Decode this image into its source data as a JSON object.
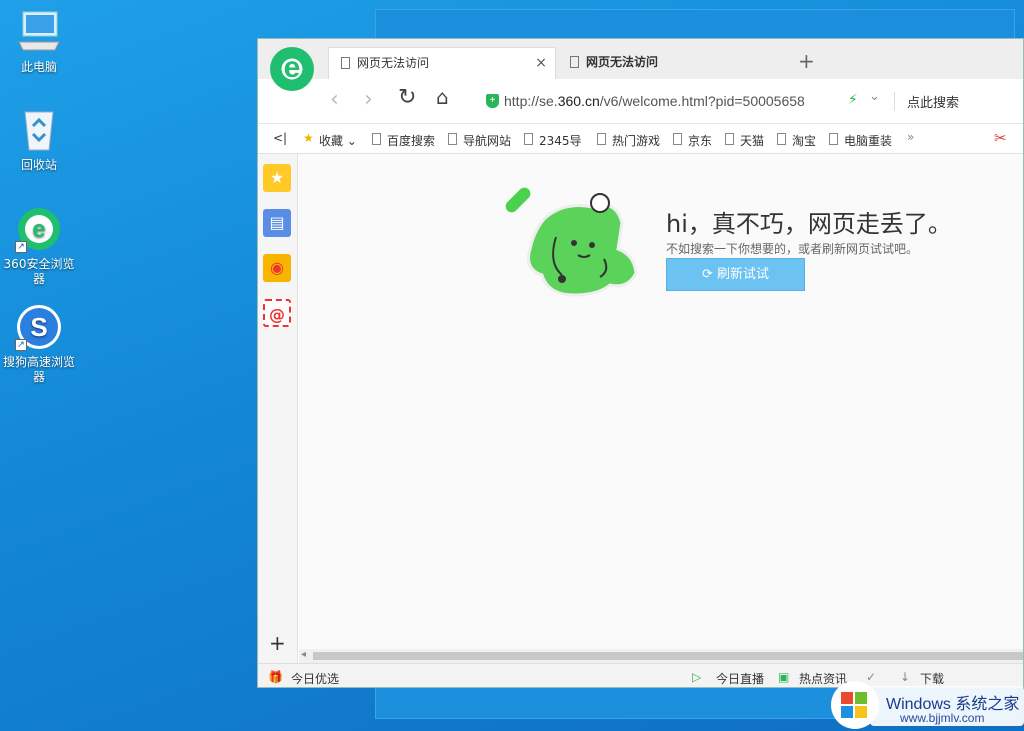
{
  "desktop": {
    "icons": [
      {
        "label": "此电脑"
      },
      {
        "label": "回收站"
      },
      {
        "label": "360安全浏览器"
      },
      {
        "label": "搜狗高速浏览器"
      }
    ]
  },
  "browser": {
    "tabs": [
      {
        "label": "网页无法访问"
      },
      {
        "label": "网页无法访问"
      }
    ],
    "new_tab": "+",
    "address": {
      "prefix": "http://se.",
      "domain": "360.cn",
      "suffix": "/v6/welcome.html?pid=50005658"
    },
    "search_button": "点此搜索",
    "favorites_toggle": "<|",
    "favorites": [
      {
        "label": "收藏"
      },
      {
        "label": "百度搜索"
      },
      {
        "label": "导航网站"
      },
      {
        "label": "2345导"
      },
      {
        "label": "热门游戏"
      },
      {
        "label": "京东"
      },
      {
        "label": "天猫"
      },
      {
        "label": "淘宝"
      },
      {
        "label": "电脑重装"
      }
    ],
    "more": "»",
    "error": {
      "title": "hi，真不巧，网页走丢了。",
      "subtitle": "不如搜索一下你想要的，或者刷新网页试试吧。",
      "retry_label": "刷新试试"
    },
    "statusbar": {
      "left": "今日优选",
      "live": "今日直播",
      "news": "热点资讯",
      "download": "下载"
    },
    "sidebar_add": "+"
  },
  "watermark": {
    "title": "Windows 系统之家",
    "url": "www.bjjmlv.com"
  }
}
